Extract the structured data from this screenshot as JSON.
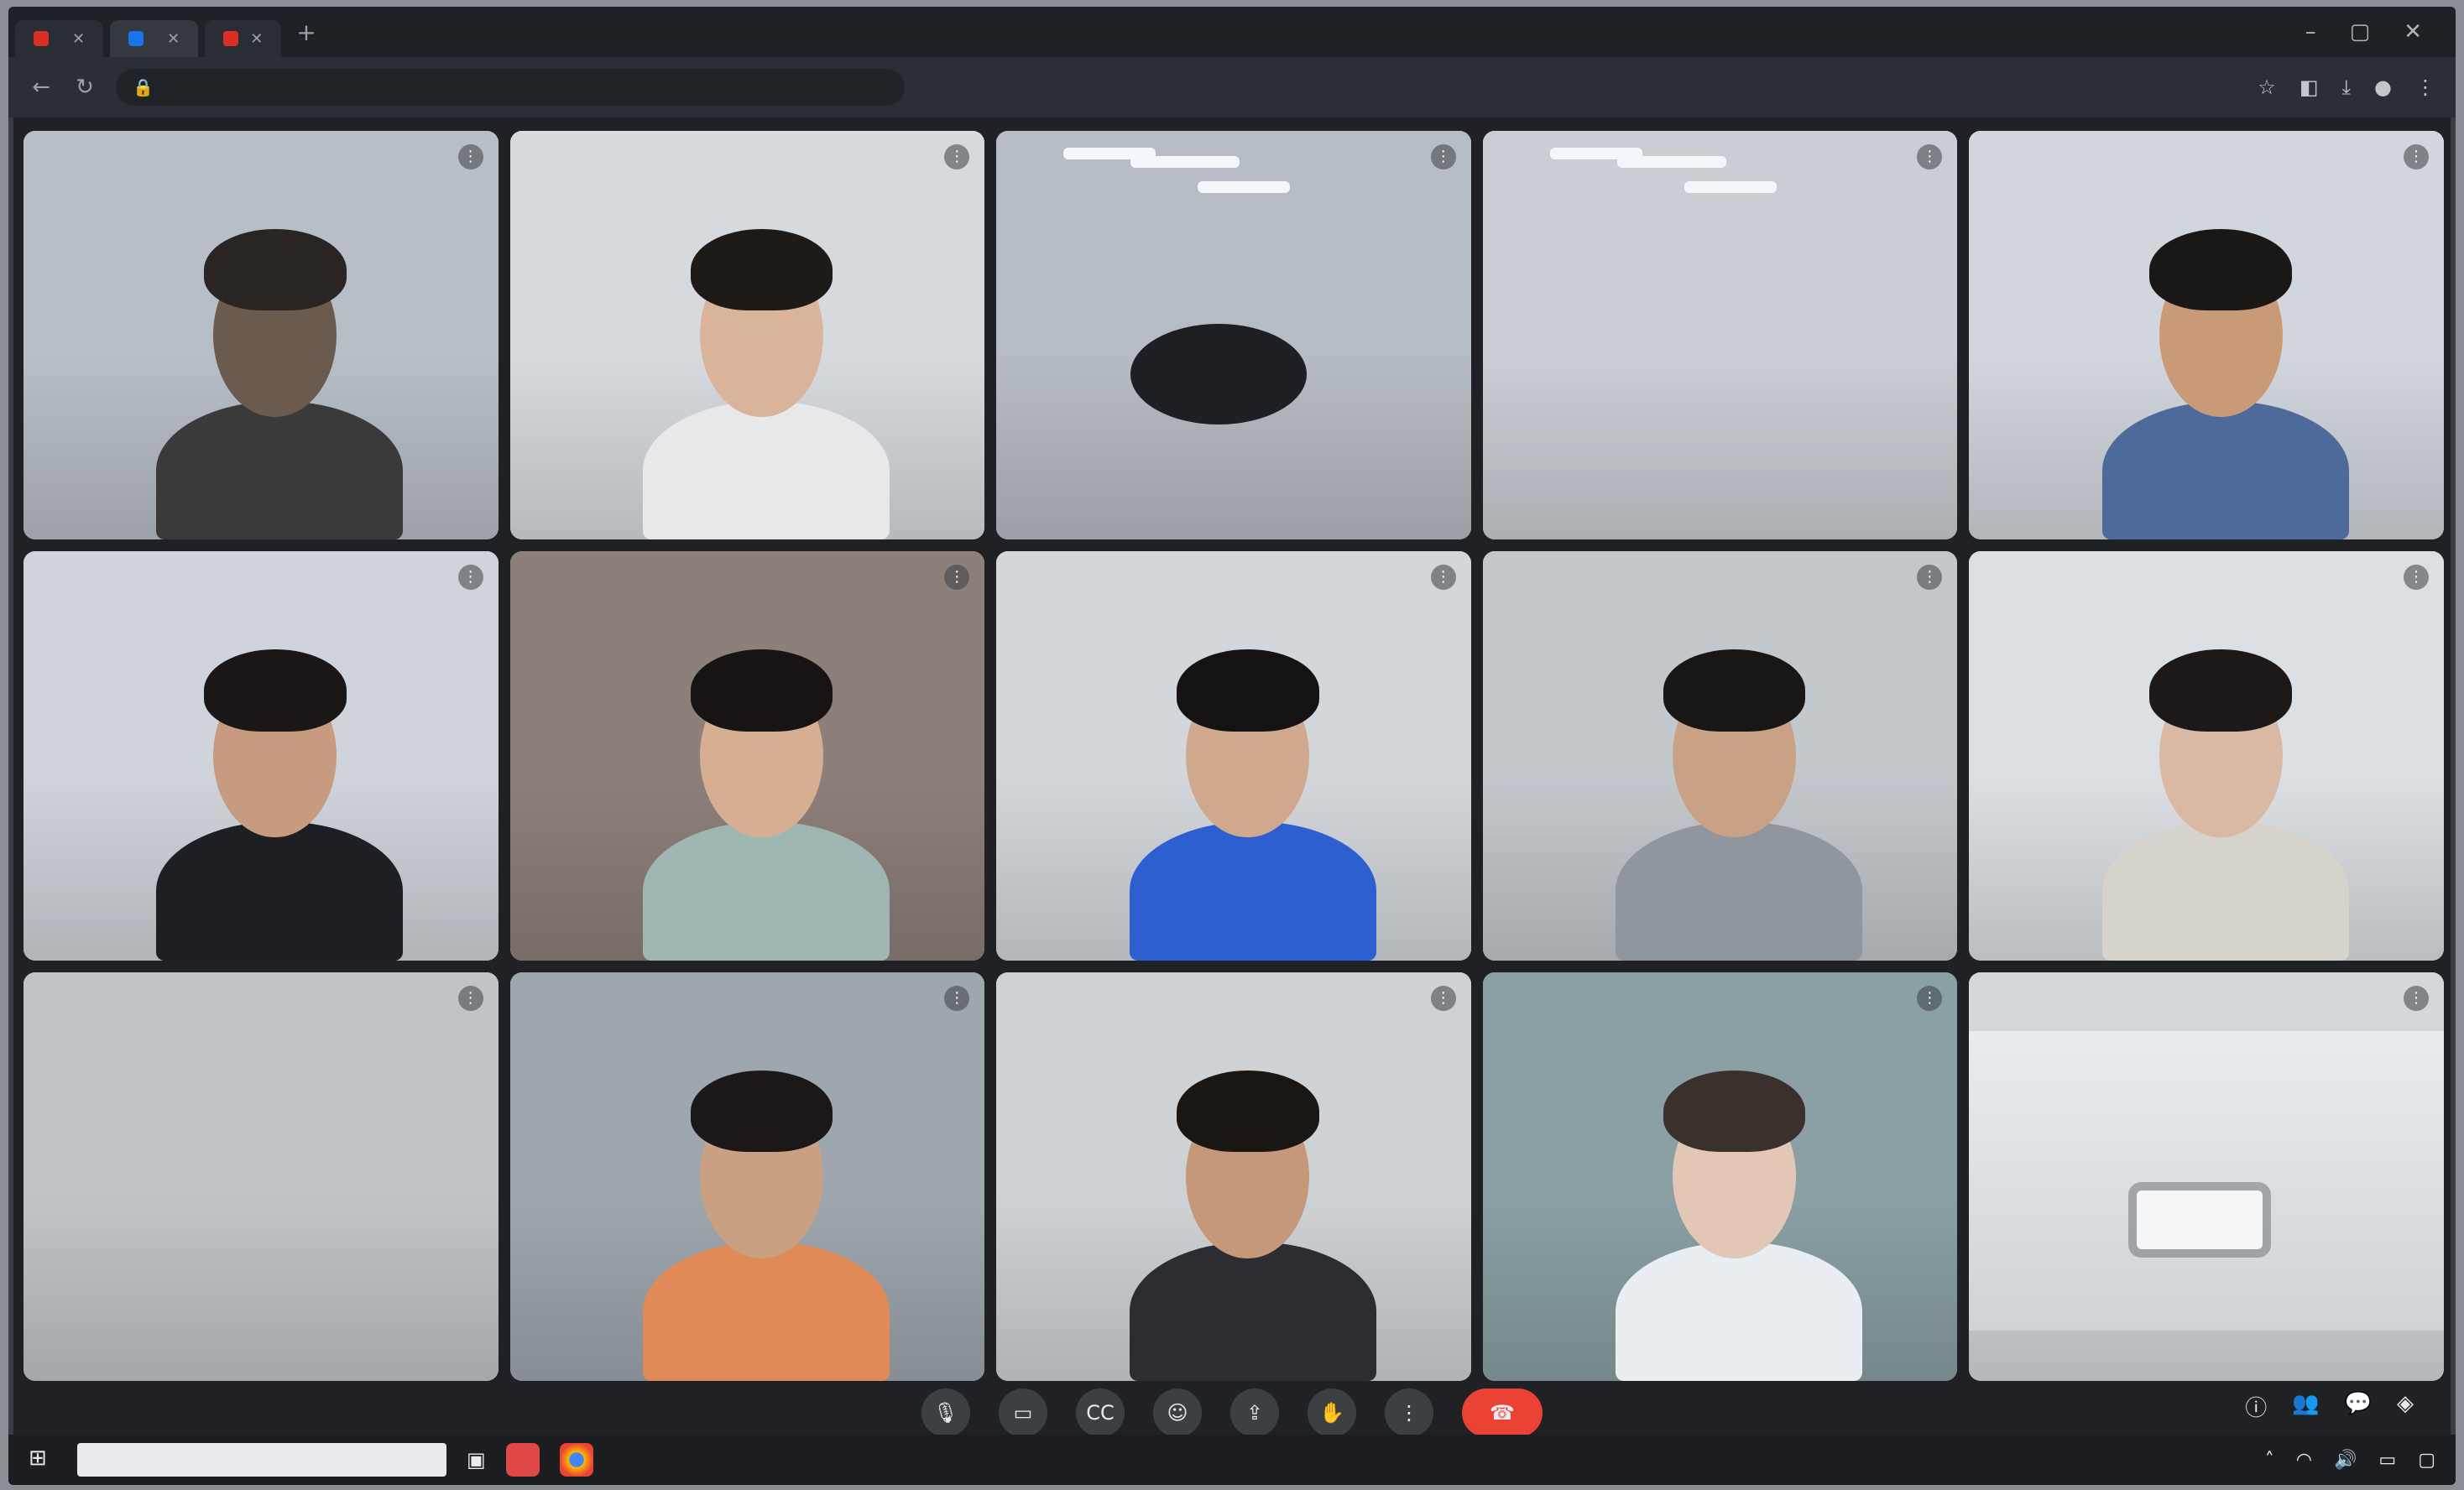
{
  "browser": {
    "tabs": [
      {
        "label": "",
        "favicon_color": "#d93025",
        "active": false
      },
      {
        "label": "",
        "favicon_color": "#1a73e8",
        "active": true
      },
      {
        "label": "",
        "favicon_color": "#d93025",
        "active": false
      }
    ],
    "new_tab_icon": "plus-icon",
    "address": ""
  },
  "meeting": {
    "participants": [
      {
        "name": "",
        "bg": "#b8bec6",
        "person": {
          "skin": "#6b5a4e",
          "shirt": "#3a3a3a",
          "hair": "#2a2522"
        }
      },
      {
        "name": "",
        "bg": "#d6dadf",
        "person": {
          "skin": "#d9b49a",
          "shirt": "#e8e8ea",
          "hair": "#1e1a18"
        }
      },
      {
        "name": "",
        "bg": "#b6bcc3",
        "person": null
      },
      {
        "name": "",
        "bg": "#c9ced4",
        "person": null
      },
      {
        "name": "",
        "bg": "#d1d6dc",
        "person": {
          "skin": "#c89a78",
          "shirt": "#4d6a9a",
          "hair": "#1a1816"
        }
      },
      {
        "name": "",
        "bg": "#cfd4da",
        "person": {
          "skin": "#c79b7f",
          "shirt": "#1e1f24",
          "hair": "#1a1716"
        },
        "speaking": true
      },
      {
        "name": "",
        "bg": "#8d7f7a",
        "person": {
          "skin": "#d6ae92",
          "shirt": "#9fb6b2",
          "hair": "#171413"
        }
      },
      {
        "name": "",
        "bg": "#d3d7dc",
        "person": {
          "skin": "#d0a88e",
          "shirt": "#2d5fd0",
          "hair": "#141212"
        }
      },
      {
        "name": "",
        "bg": "#c3c8cd",
        "person": {
          "skin": "#c9a286",
          "shirt": "#8f969e",
          "hair": "#191716"
        }
      },
      {
        "name": "",
        "bg": "#dcdfe3",
        "person": {
          "skin": "#d9b9a3",
          "shirt": "#d6d2cc",
          "hair": "#1c1918"
        }
      },
      {
        "name": "",
        "bg": "#c0c4c9",
        "person": null
      },
      {
        "name": "",
        "bg": "#9ea6ae",
        "person": {
          "skin": "#caa083",
          "shirt": "#e08a57",
          "hair": "#1b1817"
        }
      },
      {
        "name": "",
        "bg": "#cfd2d4",
        "person": {
          "skin": "#c5987a",
          "shirt": "#2c2d30",
          "hair": "#191614"
        }
      },
      {
        "name": "",
        "bg": "#8aa0a2",
        "person": {
          "skin": "#e2c7b6",
          "shirt": "#e9eef2",
          "hair": "#3a302c"
        }
      },
      {
        "name": "",
        "bg": "#d4d8dc",
        "person": null
      }
    ],
    "info_text": "",
    "controls": [
      {
        "icon": "mic-icon",
        "label": "mic"
      },
      {
        "icon": "camera-icon",
        "label": "camera"
      },
      {
        "icon": "captions-icon",
        "label": "captions"
      },
      {
        "icon": "emoji-icon",
        "label": "emoji"
      },
      {
        "icon": "present-icon",
        "label": "present"
      },
      {
        "icon": "raise-hand-icon",
        "label": "raise hand"
      },
      {
        "icon": "more-options-icon",
        "label": "more"
      },
      {
        "icon": "end-call-icon",
        "label": "end call"
      }
    ]
  },
  "taskbar": {
    "search_placeholder": "",
    "apps": [
      {
        "icon": "record-app-icon",
        "color": "#e04848"
      },
      {
        "icon": "chrome-icon",
        "color": "#e8b12c"
      }
    ]
  }
}
